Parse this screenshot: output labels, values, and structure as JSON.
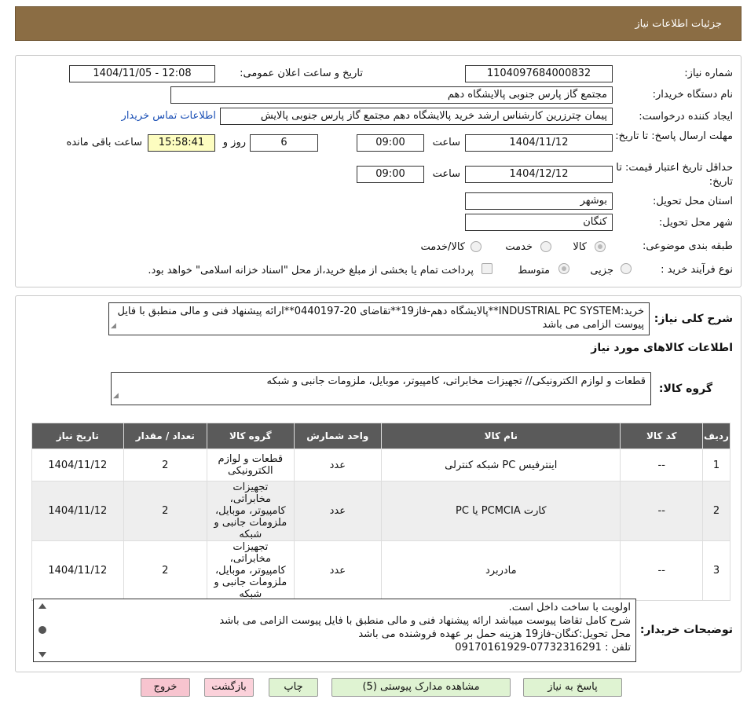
{
  "header": {
    "title": "جزئیات اطلاعات نیاز"
  },
  "form": {
    "need_number_label": "شماره نیاز:",
    "need_number": "1104097684000832",
    "announce_label": "تاریخ و ساعت اعلان عمومی:",
    "announce_value": "1404/11/05 - 12:08",
    "buyer_org_label": "نام دستگاه خریدار:",
    "buyer_org": "مجتمع گاز پارس جنوبی  پالایشگاه دهم",
    "creator_label": "ایجاد کننده درخواست:",
    "creator": "پیمان چترزرین کارشناس ارشد خرید پالایشگاه دهم مجتمع گاز پارس جنوبی  پالایش",
    "contact_link": "اطلاعات تماس خریدار",
    "reply_deadline_label": "مهلت ارسال پاسخ: تا تاریخ:",
    "reply_date": "1404/11/12",
    "time_label": "ساعت",
    "reply_time": "09:00",
    "days_value": "6",
    "days_label": "روز و",
    "remaining_time": "15:58:41",
    "remaining_label": "ساعت باقی مانده",
    "validity_label": "حداقل تاریخ اعتبار قیمت: تا تاریخ:",
    "validity_date": "1404/12/12",
    "validity_time": "09:00",
    "province_label": "استان محل تحویل:",
    "province": "بوشهر",
    "city_label": "شهر محل تحویل:",
    "city": "کنگان",
    "category_label": "طبقه بندی موضوعی:",
    "cat_goods": "کالا",
    "cat_service": "خدمت",
    "cat_goods_service": "کالا/خدمت",
    "process_label": "نوع فرآیند خرید :",
    "proc_minor": "جزیی",
    "proc_medium": "متوسط",
    "payment_note": "پرداخت تمام یا بخشی از مبلغ خرید،از محل \"اسناد خزانه اسلامی\" خواهد بود."
  },
  "summary": {
    "label": "شرح کلی نیاز:",
    "text": "خرید:INDUSTRIAL PC SYSTEM**پالایشگاه دهم-فاز19**تقاضای 20-0440197**ارائه پیشنهاد فنی و مالی منطبق با فایل پیوست الزامی می باشد"
  },
  "goods_section_title": "اطلاعات کالاهای مورد نیاز",
  "goods_group": {
    "label": "گروه کالا:",
    "value": "قطعات و لوازم الکترونیکی// تجهیزات مخابراتی، کامپیوتر، موبایل، ملزومات جانبی و شبکه"
  },
  "table": {
    "headers": [
      "ردیف",
      "کد کالا",
      "نام کالا",
      "واحد شمارش",
      "گروه کالا",
      "تعداد / مقدار",
      "تاریخ نیاز"
    ],
    "rows": [
      {
        "idx": "1",
        "code": "--",
        "name": "اینترفیس PC شبکه کنترلی",
        "unit": "عدد",
        "group": "قطعات و لوازم الکترونیکی",
        "qty": "2",
        "date": "1404/11/12"
      },
      {
        "idx": "2",
        "code": "--",
        "name": "کارت PCMCIA یا PC",
        "unit": "عدد",
        "group": "تجهیزات مخابراتی، کامپیوتر، موبایل، ملزومات جانبی و شبکه",
        "qty": "2",
        "date": "1404/11/12"
      },
      {
        "idx": "3",
        "code": "--",
        "name": "مادربرد",
        "unit": "عدد",
        "group": "تجهیزات مخابراتی، کامپیوتر، موبایل، ملزومات جانبی و شبکه",
        "qty": "2",
        "date": "1404/11/12"
      }
    ]
  },
  "buyer_notes": {
    "label": "توضیحات خریدار:",
    "lines": [
      "اولویت با ساخت داخل است.",
      "شرح کامل تقاضا پیوست میباشد ارائه پیشنهاد فنی و مالی منطبق با فایل پیوست الزامی می باشد",
      "محل تحویل:کنگان-فاز19 هزینه حمل بر عهده فروشنده می باشد",
      "تلفن : 07732316291-09170161929"
    ]
  },
  "buttons": {
    "reply": "پاسخ به نیاز",
    "attachments": "مشاهده مدارک پیوستی (5)",
    "print": "چاپ",
    "back": "بازگشت",
    "exit": "خروج"
  },
  "watermark": "AriaTender.neT",
  "colors": {
    "header": "#8b6d44",
    "table_header": "#5a5a5a",
    "link": "#1a4fb5"
  }
}
